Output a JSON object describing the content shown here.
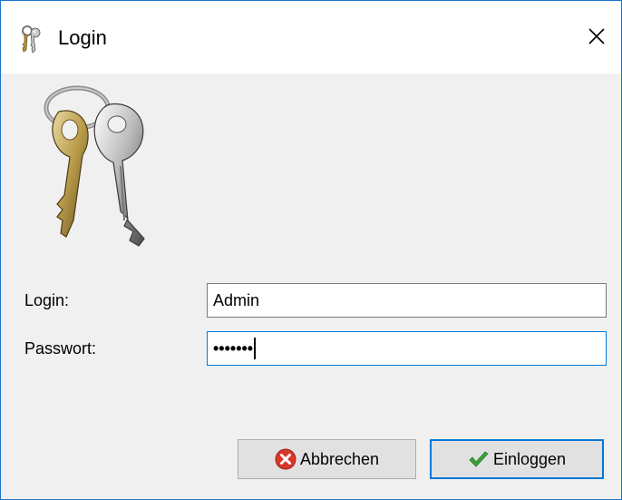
{
  "window": {
    "title": "Login",
    "title_icon": "keys-icon",
    "close_icon": "close-icon"
  },
  "image": {
    "name": "keys-image"
  },
  "form": {
    "login_label": "Login:",
    "login_value": "Admin",
    "password_label": "Passwort:",
    "password_masked": "•••••••"
  },
  "buttons": {
    "cancel_label": "Abbrechen",
    "cancel_icon": "cancel-x-icon",
    "login_label": "Einloggen",
    "login_icon": "checkmark-icon"
  },
  "colors": {
    "window_border": "#1a74c9",
    "background": "#f0f0f0",
    "focus_border": "#0078d7",
    "cancel_icon_red": "#d9362a",
    "check_green": "#3aa53a"
  }
}
